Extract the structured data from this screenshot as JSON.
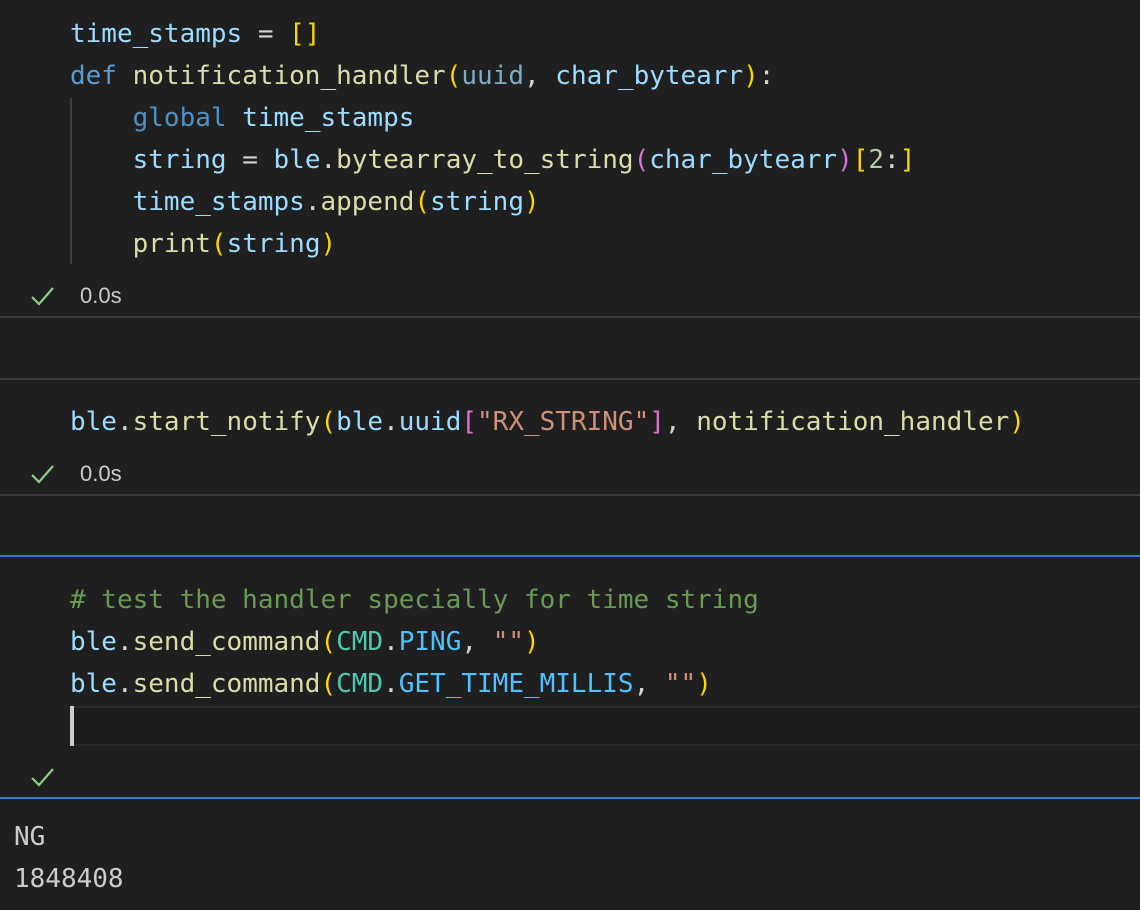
{
  "cells": [
    {
      "lines": [
        {
          "tokens": [
            {
              "text": "time_stamps",
              "cls": "var"
            },
            {
              "text": " = ",
              "cls": "op"
            },
            {
              "text": "[]",
              "cls": "br1"
            }
          ]
        },
        {
          "tokens": [
            {
              "text": "def",
              "cls": "kw"
            },
            {
              "text": " ",
              "cls": "op"
            },
            {
              "text": "notification_handler",
              "cls": "fn"
            },
            {
              "text": "(",
              "cls": "br1"
            },
            {
              "text": "uuid",
              "cls": "param"
            },
            {
              "text": ", ",
              "cls": "op"
            },
            {
              "text": "char_bytearr",
              "cls": "var"
            },
            {
              "text": ")",
              "cls": "br1"
            },
            {
              "text": ":",
              "cls": "op"
            }
          ]
        },
        {
          "tokens": [
            {
              "text": "    ",
              "cls": "op"
            },
            {
              "text": "global",
              "cls": "kw2"
            },
            {
              "text": " ",
              "cls": "op"
            },
            {
              "text": "time_stamps",
              "cls": "var"
            }
          ]
        },
        {
          "tokens": [
            {
              "text": "    ",
              "cls": "op"
            },
            {
              "text": "string",
              "cls": "var"
            },
            {
              "text": " = ",
              "cls": "op"
            },
            {
              "text": "ble",
              "cls": "var"
            },
            {
              "text": ".",
              "cls": "op"
            },
            {
              "text": "bytearray_to_string",
              "cls": "fn"
            },
            {
              "text": "(",
              "cls": "br2"
            },
            {
              "text": "char_bytearr",
              "cls": "var"
            },
            {
              "text": ")",
              "cls": "br2"
            },
            {
              "text": "[",
              "cls": "br1"
            },
            {
              "text": "2",
              "cls": "num"
            },
            {
              "text": ":",
              "cls": "op"
            },
            {
              "text": "]",
              "cls": "br1"
            }
          ]
        },
        {
          "tokens": [
            {
              "text": "    ",
              "cls": "op"
            },
            {
              "text": "time_stamps",
              "cls": "var"
            },
            {
              "text": ".",
              "cls": "op"
            },
            {
              "text": "append",
              "cls": "fn"
            },
            {
              "text": "(",
              "cls": "br1"
            },
            {
              "text": "string",
              "cls": "var"
            },
            {
              "text": ")",
              "cls": "br1"
            }
          ]
        },
        {
          "tokens": [
            {
              "text": "    ",
              "cls": "op"
            },
            {
              "text": "print",
              "cls": "fn"
            },
            {
              "text": "(",
              "cls": "br1"
            },
            {
              "text": "string",
              "cls": "var"
            },
            {
              "text": ")",
              "cls": "br1"
            }
          ]
        }
      ],
      "status": {
        "icon": "check-icon",
        "time": "0.0s"
      }
    },
    {
      "lines": [
        {
          "tokens": [
            {
              "text": "ble",
              "cls": "var"
            },
            {
              "text": ".",
              "cls": "op"
            },
            {
              "text": "start_notify",
              "cls": "fn"
            },
            {
              "text": "(",
              "cls": "br1"
            },
            {
              "text": "ble",
              "cls": "var"
            },
            {
              "text": ".",
              "cls": "op"
            },
            {
              "text": "uuid",
              "cls": "var"
            },
            {
              "text": "[",
              "cls": "br2"
            },
            {
              "text": "\"RX_STRING\"",
              "cls": "str"
            },
            {
              "text": "]",
              "cls": "br2"
            },
            {
              "text": ", ",
              "cls": "op"
            },
            {
              "text": "notification_handler",
              "cls": "fn"
            },
            {
              "text": ")",
              "cls": "br1"
            }
          ]
        }
      ],
      "status": {
        "icon": "check-icon",
        "time": "0.0s"
      }
    },
    {
      "lines": [
        {
          "tokens": [
            {
              "text": "# test the handler specially for time string",
              "cls": "cmt"
            }
          ]
        },
        {
          "tokens": [
            {
              "text": "ble",
              "cls": "var"
            },
            {
              "text": ".",
              "cls": "op"
            },
            {
              "text": "send_command",
              "cls": "fn"
            },
            {
              "text": "(",
              "cls": "br1"
            },
            {
              "text": "CMD",
              "cls": "cls"
            },
            {
              "text": ".",
              "cls": "op"
            },
            {
              "text": "PING",
              "cls": "const"
            },
            {
              "text": ", ",
              "cls": "op"
            },
            {
              "text": "\"\"",
              "cls": "str"
            },
            {
              "text": ")",
              "cls": "br1"
            }
          ]
        },
        {
          "tokens": [
            {
              "text": "ble",
              "cls": "var"
            },
            {
              "text": ".",
              "cls": "op"
            },
            {
              "text": "send_command",
              "cls": "fn"
            },
            {
              "text": "(",
              "cls": "br1"
            },
            {
              "text": "CMD",
              "cls": "cls"
            },
            {
              "text": ".",
              "cls": "op"
            },
            {
              "text": "GET_TIME_MILLIS",
              "cls": "const"
            },
            {
              "text": ", ",
              "cls": "op"
            },
            {
              "text": "\"\"",
              "cls": "str"
            },
            {
              "text": ")",
              "cls": "br1"
            }
          ]
        }
      ],
      "status": {
        "icon": "check-icon",
        "time": ""
      }
    }
  ],
  "output": {
    "lines": [
      "NG",
      "1848408"
    ]
  },
  "colors": {
    "background": "#1f1f1f",
    "success_check": "#89d185",
    "focus_border": "#2f7cd1"
  }
}
